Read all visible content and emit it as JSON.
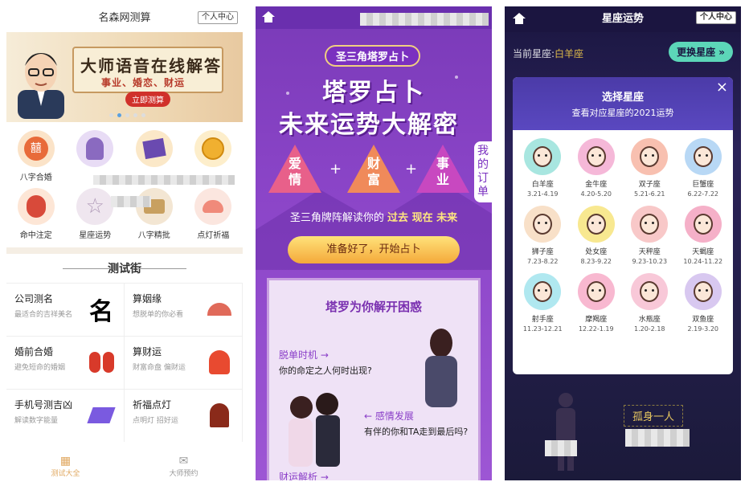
{
  "panel1": {
    "title": "名森网测算",
    "user_center": "个人中心",
    "banner": {
      "headline": "大师语音在线解答",
      "subline": "事业、婚恋、财运",
      "cta": "立即测算"
    },
    "icons": [
      {
        "label": "八字合婚",
        "color": "#f4b57a"
      },
      {
        "label": "",
        "color": "#c8b0e8"
      },
      {
        "label": "",
        "color": "#f5c98a"
      },
      {
        "label": "",
        "color": "#f8d27a"
      },
      {
        "label": "命中注定",
        "color": "#f3c0a0"
      },
      {
        "label": "星座运势",
        "color": "#e8d8e8"
      },
      {
        "label": "八字精批",
        "color": "#e8d0b0"
      },
      {
        "label": "点灯祈福",
        "color": "#f0d0c0"
      }
    ],
    "section_title": "测试街",
    "cells": [
      {
        "name": "公司测名",
        "sub": "最适合的吉祥美名"
      },
      {
        "name": "算姻缘",
        "sub": "想脱单的你必看"
      },
      {
        "name": "婚前合婚",
        "sub": "避免短命的婚姻"
      },
      {
        "name": "算财运",
        "sub": "财富命盘 偏财运"
      },
      {
        "name": "手机号测吉凶",
        "sub": "解读数字能量"
      },
      {
        "name": "祈福点灯",
        "sub": "点明灯 招好运"
      }
    ],
    "tabs": [
      "测试大全",
      "大师预约"
    ]
  },
  "panel2": {
    "pill": "圣三角塔罗占卜",
    "headline1": "塔罗占卜",
    "headline2": "未来运势大解密",
    "side_tab": "我的订单",
    "triangles": [
      "爱情",
      "财富",
      "事业"
    ],
    "tagline_prefix": "圣三角牌阵解读你的",
    "tagline_highlight": "过去 现在 未来",
    "start": "准备好了，开始占卜",
    "card_title": "塔罗为你解开困惑",
    "k1": "脱单时机 →",
    "q1": "你的命定之人何时出现?",
    "k2": "← 感情发展",
    "q2": "有伴的你和TA走到最后吗?",
    "k3": "财运解析 →"
  },
  "panel3": {
    "title": "星座运势",
    "user_center": "个人中心",
    "current_prefix": "当前星座:",
    "current": "白羊座",
    "change": "更换星座 »",
    "modal_title": "选择星座",
    "modal_sub": "查看对应星座的2021运势",
    "close": "×",
    "signs": [
      {
        "name": "白羊座",
        "date": "3.21-4.19",
        "color": "#a8e6e0"
      },
      {
        "name": "金牛座",
        "date": "4.20-5.20",
        "color": "#f5b8d8"
      },
      {
        "name": "双子座",
        "date": "5.21-6.21",
        "color": "#f8c0b0"
      },
      {
        "name": "巨蟹座",
        "date": "6.22-7.22",
        "color": "#b8d8f5"
      },
      {
        "name": "狮子座",
        "date": "7.23-8.22",
        "color": "#f8e0c8"
      },
      {
        "name": "处女座",
        "date": "8.23-9.22",
        "color": "#f8e890"
      },
      {
        "name": "天秤座",
        "date": "9.23-10.23",
        "color": "#f8c8c8"
      },
      {
        "name": "天蝎座",
        "date": "10.24-11.22",
        "color": "#f5b0c8"
      },
      {
        "name": "射手座",
        "date": "11.23-12.21",
        "color": "#b0e8f0"
      },
      {
        "name": "摩羯座",
        "date": "12.22-1.19",
        "color": "#f8b8d0"
      },
      {
        "name": "水瓶座",
        "date": "1.20-2.18",
        "color": "#f8c8d8"
      },
      {
        "name": "双鱼座",
        "date": "2.19-3.20",
        "color": "#d8c8f0"
      }
    ],
    "lonely": "孤身一人"
  }
}
